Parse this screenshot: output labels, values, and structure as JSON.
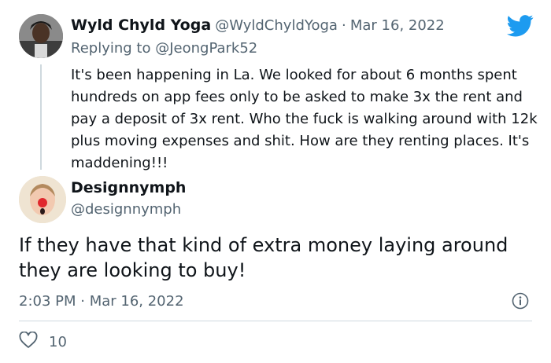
{
  "parent_tweet": {
    "author_name": "Wyld Chyld Yoga",
    "handle": "@WyldChyldYoga",
    "separator": "·",
    "date": "Mar 16, 2022",
    "replying_to_prefix": "Replying to",
    "replying_to_handle": "@JeongPark52",
    "text": "It's been happening in La. We looked for about 6 months spent hundreds on app fees only to be asked to make 3x the rent and pay a deposit of 3x rent. Who the fuck is walking around with 12k plus moving expenses and shit. How are they renting places. It's maddening!!!"
  },
  "reply_tweet": {
    "author_name": "Designnymph",
    "handle": "@designnymph",
    "text": "If they have that kind of extra money laying around they are looking to buy!",
    "timestamp": "2:03 PM · Mar 16, 2022",
    "likes": "10"
  },
  "icons": {
    "brand": "twitter-bird-icon",
    "info": "info-icon",
    "like": "heart-icon"
  },
  "colors": {
    "brand": "#1d9bf0",
    "text": "#0f1419",
    "muted": "#536471",
    "divider": "#cfd9de"
  }
}
